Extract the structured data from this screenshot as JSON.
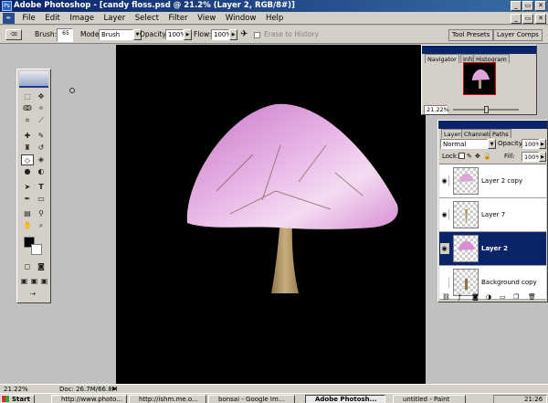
{
  "window": {
    "title": "Adobe Photoshop - [candy floss.psd @ 21.2% (Layer 2, RGB/8#)]"
  },
  "menu": [
    "File",
    "Edit",
    "Image",
    "Layer",
    "Select",
    "Filter",
    "View",
    "Window",
    "Help"
  ],
  "options": {
    "brush_label": "Brush:",
    "brush_size": "65",
    "mode_label": "Mode:",
    "mode_value": "Brush",
    "opacity_label": "Opacity:",
    "opacity_value": "100%",
    "flow_label": "Flow:",
    "flow_value": "100%",
    "erase_history": "Erase to History",
    "tool_presets_tab": "Tool Presets",
    "layer_comps_tab": "Layer Comps"
  },
  "navigator": {
    "tabs": [
      "Navigator",
      "Info",
      "Histogram"
    ],
    "zoom": "21.22%"
  },
  "layers_panel": {
    "tabs": [
      "Layers",
      "Channels",
      "Paths"
    ],
    "blend_mode": "Normal",
    "opacity_label": "Opacity:",
    "opacity_value": "100%",
    "lock_label": "Lock:",
    "fill_label": "Fill:",
    "fill_value": "100%",
    "layers": [
      {
        "name": "Layer 2 copy",
        "visible": true,
        "selected": false
      },
      {
        "name": "Layer 7",
        "visible": true,
        "selected": false
      },
      {
        "name": "Layer 2",
        "visible": true,
        "selected": true
      },
      {
        "name": "Background copy",
        "visible": false,
        "selected": false
      }
    ]
  },
  "status": {
    "zoom": "21.22%",
    "doc": "Doc: 26.7M/66.8M"
  },
  "taskbar": {
    "start": "Start",
    "tasks": [
      {
        "label": "http://www.photo...",
        "active": false
      },
      {
        "label": "http://ishm.me.o...",
        "active": false
      },
      {
        "label": "bonsai - Google Im...",
        "active": false
      },
      {
        "label": "Adobe Photosh...",
        "active": true
      },
      {
        "label": "untitled - Paint",
        "active": false
      }
    ],
    "clock": "21:26"
  },
  "colors": {
    "title_bar": "#0a246a",
    "canvas_bg": "#000000",
    "selection": "#0a246a",
    "mushroom_cap": "#d890d8",
    "stem": "#b49a6a"
  }
}
